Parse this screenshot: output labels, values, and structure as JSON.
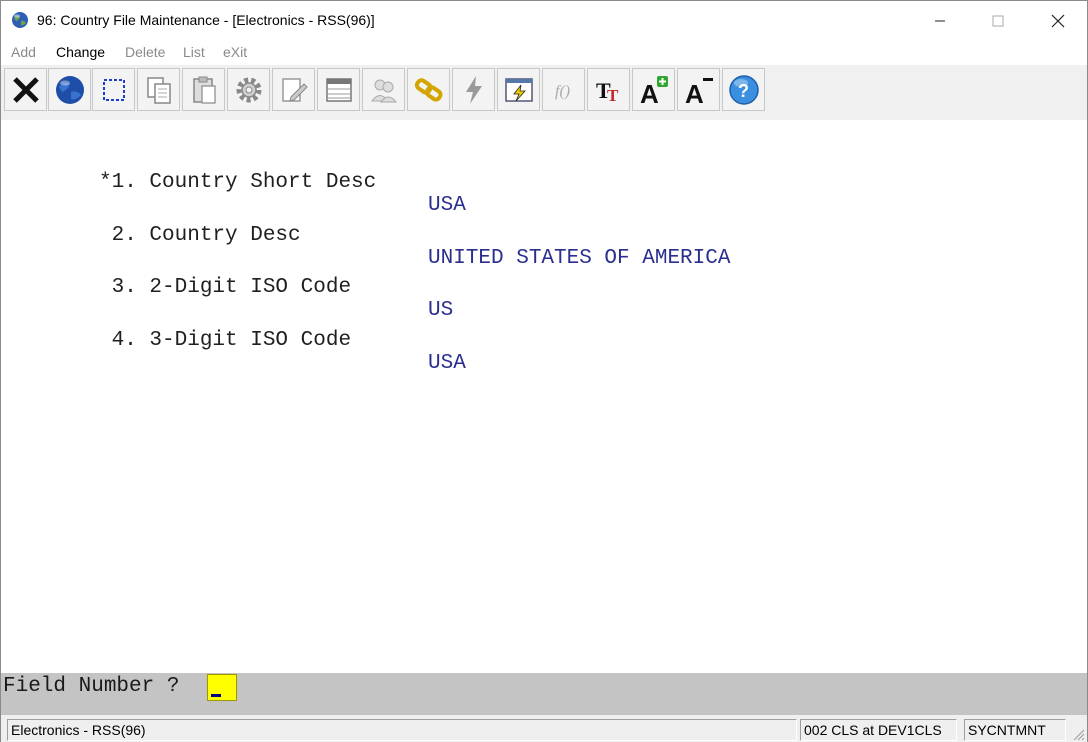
{
  "window": {
    "title": "96: Country File Maintenance - [Electronics - RSS(96)]",
    "app_icon": "globe-icon"
  },
  "menu": {
    "items": [
      {
        "label": "Add",
        "enabled": false
      },
      {
        "label": "Change",
        "enabled": true
      },
      {
        "label": "Delete",
        "enabled": false
      },
      {
        "label": "List",
        "enabled": false
      },
      {
        "label": "eXit",
        "enabled": false
      }
    ]
  },
  "toolbar": {
    "buttons": [
      {
        "icon": "close-x-icon"
      },
      {
        "icon": "globe-icon"
      },
      {
        "icon": "select-rectangle-icon"
      },
      {
        "icon": "copy-icon"
      },
      {
        "icon": "paste-icon"
      },
      {
        "icon": "settings-gear-icon"
      },
      {
        "icon": "edit-document-icon"
      },
      {
        "icon": "table-view-icon"
      },
      {
        "icon": "users-icon"
      },
      {
        "icon": "link-chain-icon"
      },
      {
        "icon": "lightning-icon"
      },
      {
        "icon": "flash-window-icon"
      },
      {
        "icon": "function-icon"
      },
      {
        "icon": "font-tt-icon"
      },
      {
        "icon": "font-increase-icon"
      },
      {
        "icon": "font-decrease-icon"
      },
      {
        "icon": "help-icon"
      }
    ]
  },
  "fields": [
    {
      "label": "*1. Country Short Desc",
      "value": "USA"
    },
    {
      "label": " 2. Country Desc",
      "value": "UNITED STATES OF AMERICA"
    },
    {
      "label": " 3. 2-Digit ISO Code",
      "value": "US"
    },
    {
      "label": " 4. 3-Digit ISO Code",
      "value": "USA"
    }
  ],
  "prompt": {
    "text": "Field Number ?",
    "input_value": ""
  },
  "status": {
    "company": "Electronics - RSS(96)",
    "session": "002 CLS at DEV1CLS",
    "program": "SYCNTMNT"
  },
  "colors": {
    "value_text": "#2a2f8f",
    "prompt_bar": "#c4c4c4",
    "prompt_input": "#ffff00"
  }
}
